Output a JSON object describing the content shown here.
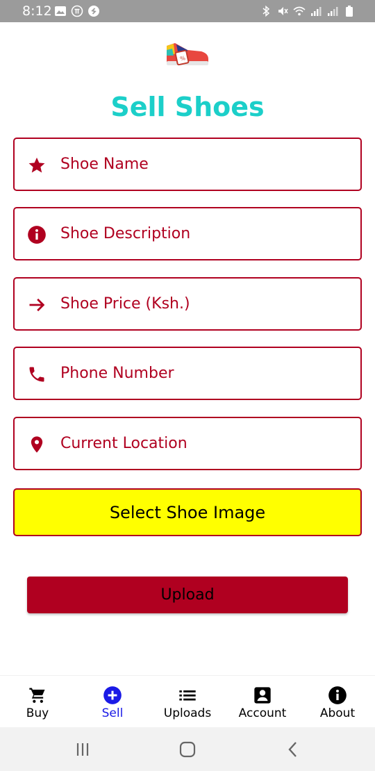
{
  "status_bar": {
    "time": "8:12",
    "left_icons": [
      "image-icon",
      "pi-icon",
      "shazam-icon"
    ],
    "right_icons": [
      "bluetooth-icon",
      "mute-icon",
      "wifi-icon",
      "signal-icon",
      "signal-icon",
      "battery-icon"
    ]
  },
  "header": {
    "title": "Sell Shoes",
    "logo": "shoe-sale-logo"
  },
  "form": {
    "fields": [
      {
        "name": "shoe-name-field",
        "placeholder": "Shoe Name",
        "icon": "star-icon"
      },
      {
        "name": "shoe-description-field",
        "placeholder": "Shoe Description",
        "icon": "info-icon"
      },
      {
        "name": "shoe-price-field",
        "placeholder": "Shoe Price (Ksh.)",
        "icon": "arrow-right-icon"
      },
      {
        "name": "phone-number-field",
        "placeholder": "Phone Number",
        "icon": "phone-icon"
      },
      {
        "name": "current-location-field",
        "placeholder": "Current Location",
        "icon": "location-pin-icon"
      }
    ],
    "select_image_label": "Select Shoe Image",
    "upload_label": "Upload"
  },
  "bottom_nav": {
    "items": [
      {
        "label": "Buy",
        "icon": "cart-icon",
        "active": false
      },
      {
        "label": "Sell",
        "icon": "add-circle-icon",
        "active": true
      },
      {
        "label": "Uploads",
        "icon": "list-icon",
        "active": false
      },
      {
        "label": "Account",
        "icon": "account-box-icon",
        "active": false
      },
      {
        "label": "About",
        "icon": "info-icon",
        "active": false
      }
    ]
  },
  "system_nav": [
    "recents-icon",
    "home-icon",
    "back-icon"
  ],
  "colors": {
    "accent": "#b00020",
    "title": "#1ccfc9",
    "select_button": "#ffff00",
    "active_nav": "#1a1ae6",
    "status_bar": "#9b9b9b"
  }
}
